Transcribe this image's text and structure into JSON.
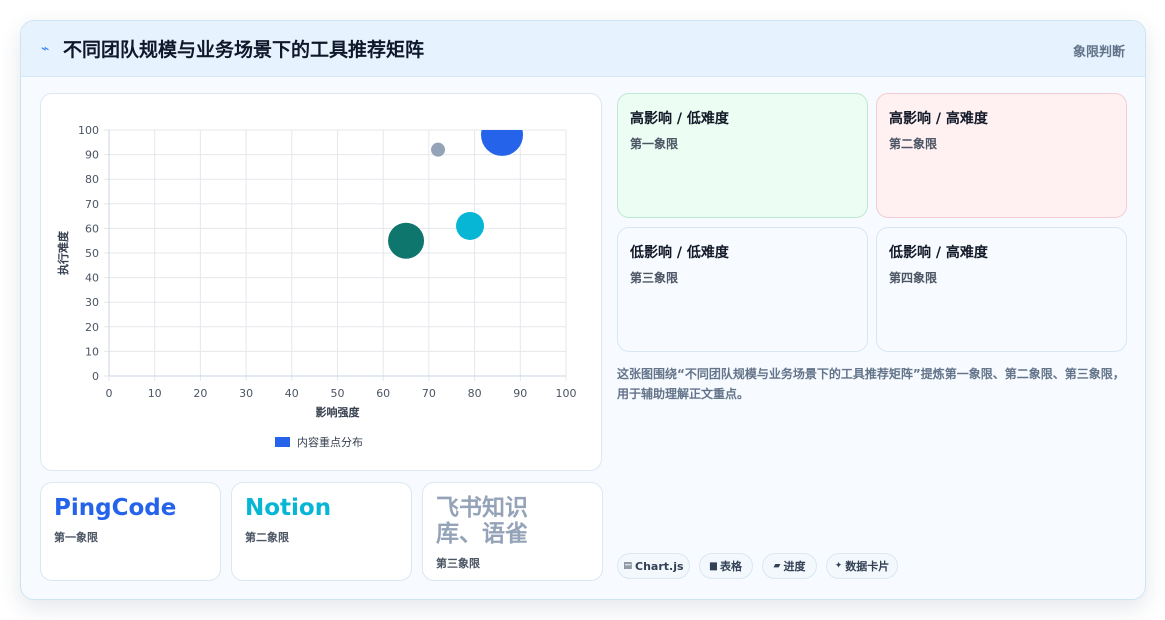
{
  "header": {
    "title": "不同团队规模与业务场景下的工具推荐矩阵",
    "tag": "象限判断",
    "icon": "lightning-icon"
  },
  "chart_data": {
    "type": "scatter",
    "xlabel": "影响强度",
    "ylabel": "执行难度",
    "xlim": [
      0,
      100
    ],
    "ylim": [
      0,
      100
    ],
    "xticks": [
      "0",
      "10",
      "20",
      "30",
      "40",
      "50",
      "60",
      "70",
      "80",
      "90",
      "100"
    ],
    "yticks": [
      "0",
      "10",
      "20",
      "30",
      "40",
      "50",
      "60",
      "70",
      "80",
      "90",
      "100"
    ],
    "grid": true,
    "legend": {
      "label": "内容重点分布",
      "position": "bottom",
      "color": "#2563eb"
    },
    "points": [
      {
        "x": 86,
        "y": 98,
        "r": 21,
        "color": "#2563eb"
      },
      {
        "x": 72,
        "y": 92,
        "r": 7,
        "color": "#94a3b8"
      },
      {
        "x": 79,
        "y": 61,
        "r": 14,
        "color": "#06b6d4"
      },
      {
        "x": 65,
        "y": 55,
        "r": 18,
        "color": "#0f766e"
      }
    ]
  },
  "quadrants": [
    {
      "title": "高影响 / 低难度",
      "sub": "第一象限",
      "bg": "#ecfdf3",
      "border": "#bfe8d0"
    },
    {
      "title": "高影响 / 高难度",
      "sub": "第二象限",
      "bg": "#fff1f2",
      "border": "#f3cdd3"
    },
    {
      "title": "低影响 / 低难度",
      "sub": "第三象限",
      "bg": "#f7fbff",
      "border": "#d6e6f3"
    },
    {
      "title": "低影响 / 高难度",
      "sub": "第四象限",
      "bg": "#f7fbff",
      "border": "#d6e6f3"
    }
  ],
  "description": "这张图围绕“不同团队规模与业务场景下的工具推荐矩阵”提炼第一象限、第二象限、第三象限，用于辅助理解正文重点。",
  "tools": [
    {
      "name": "PingCode",
      "sub": "第一象限",
      "color": "#2563eb"
    },
    {
      "name": "Notion",
      "sub": "第二象限",
      "color": "#06b6d4"
    },
    {
      "name": "飞书知识库、语雀",
      "sub": "第三象限",
      "color": "#94a3b8"
    }
  ],
  "chips": [
    {
      "icon": "chart-icon",
      "glyph": "▤",
      "label": "Chart.js"
    },
    {
      "icon": "table-icon",
      "glyph": "▆",
      "label": "表格"
    },
    {
      "icon": "progress-icon",
      "glyph": "▰",
      "label": "进度"
    },
    {
      "icon": "sparkle-icon",
      "glyph": "✦",
      "label": "数据卡片"
    }
  ]
}
